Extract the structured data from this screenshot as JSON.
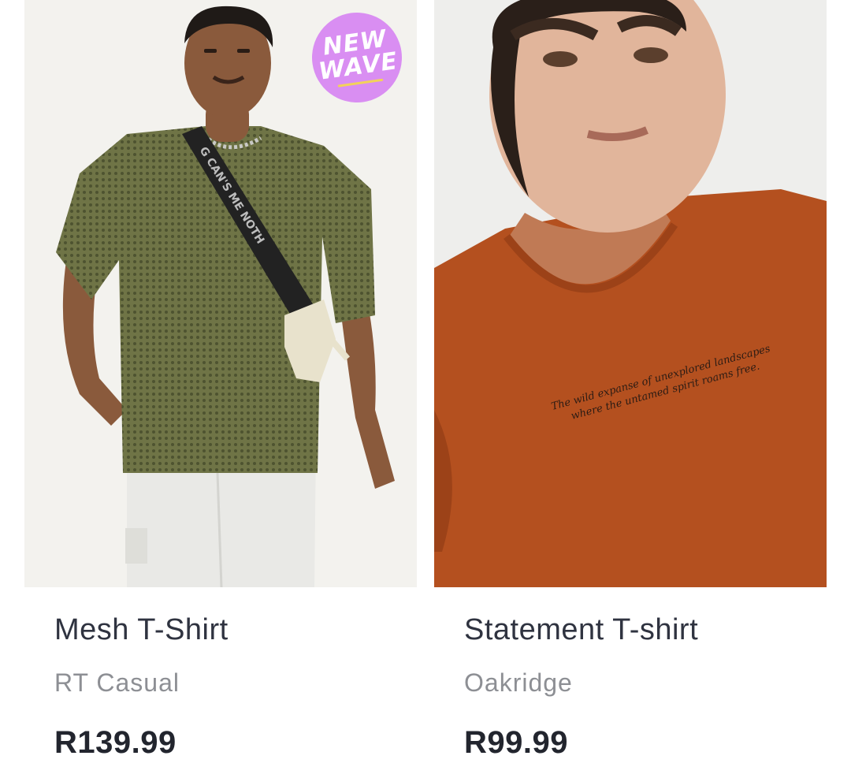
{
  "products": [
    {
      "name": "Mesh T-Shirt",
      "brand": "RT Casual",
      "price": "R139.99",
      "badge": {
        "line1": "NEW",
        "line2": "WAVE",
        "color": "#d98ef2"
      },
      "shirt_color": "#6f7446",
      "strap_text": "G CAN'S ME NOTH"
    },
    {
      "name": "Statement T-shirt",
      "brand": "Oakridge",
      "price": "R99.99",
      "shirt_color": "#b4501f",
      "shirt_print": {
        "line1": "The wild expanse of unexplored landscapes",
        "line2": "where the untamed spirit roams free."
      }
    }
  ]
}
